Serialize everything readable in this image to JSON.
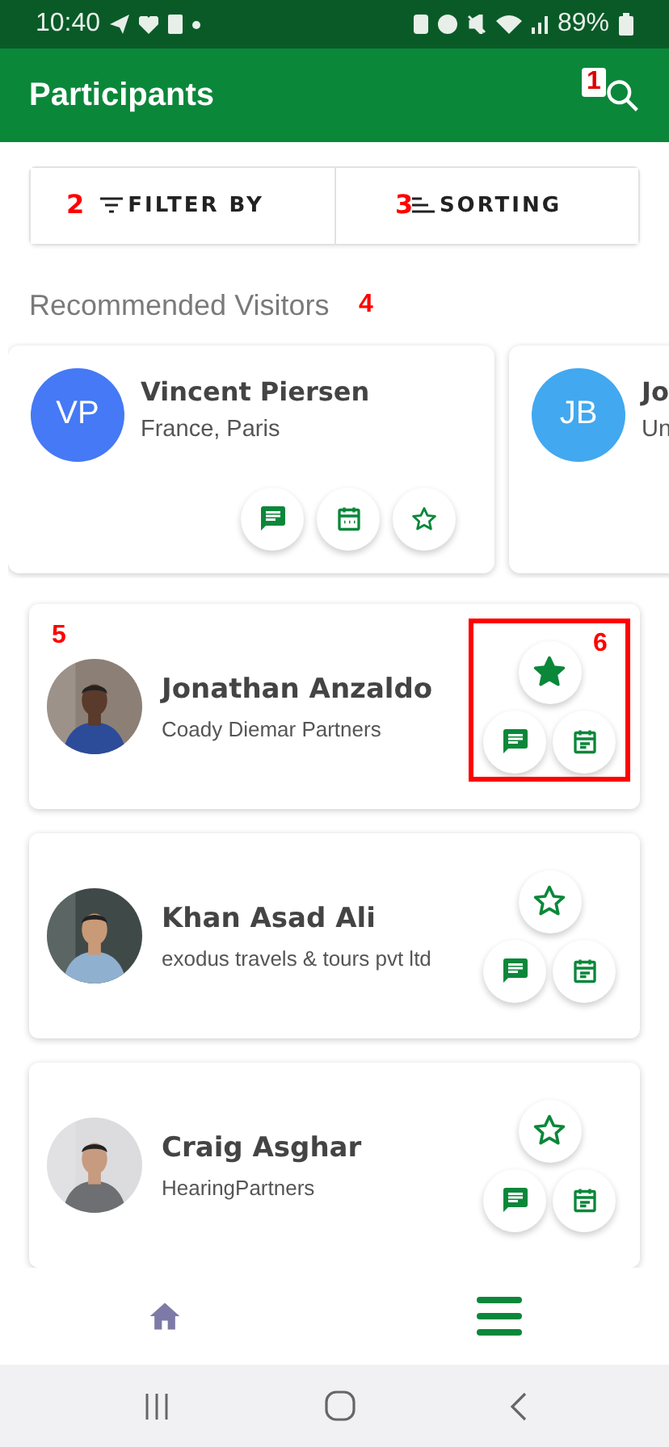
{
  "status_bar": {
    "time": "10:40",
    "battery": "89%"
  },
  "app_bar": {
    "title": "Participants",
    "search_marker": "1"
  },
  "toolbar": [
    {
      "label": "FILTER BY",
      "kind": "filter",
      "marker": "2"
    },
    {
      "label": "SORTING",
      "kind": "sort",
      "marker": "3"
    }
  ],
  "recommended": {
    "title": "Recommended Visitors",
    "marker": "4",
    "visitors": [
      {
        "initials": "VP",
        "name": "Vincent Piersen",
        "location": "France, Paris",
        "color": "#4579f5",
        "favorite": false
      },
      {
        "initials": "JB",
        "name": "Jo",
        "location": "Un",
        "color": "#42a8ef"
      }
    ]
  },
  "participants": [
    {
      "name": "Jonathan Anzaldo",
      "company": "Coady Diemar Partners",
      "favorite": true,
      "highlighted": true,
      "marker": "5",
      "highlight_marker": "6"
    },
    {
      "name": "Khan Asad Ali",
      "company": "exodus travels & tours pvt ltd",
      "favorite": false,
      "highlighted": false
    },
    {
      "name": "Craig Asghar",
      "company": "HearingPartners",
      "favorite": false,
      "highlighted": false
    }
  ],
  "bottom_nav": [
    {
      "kind": "home",
      "selected": false
    },
    {
      "kind": "menu",
      "selected": true
    }
  ]
}
